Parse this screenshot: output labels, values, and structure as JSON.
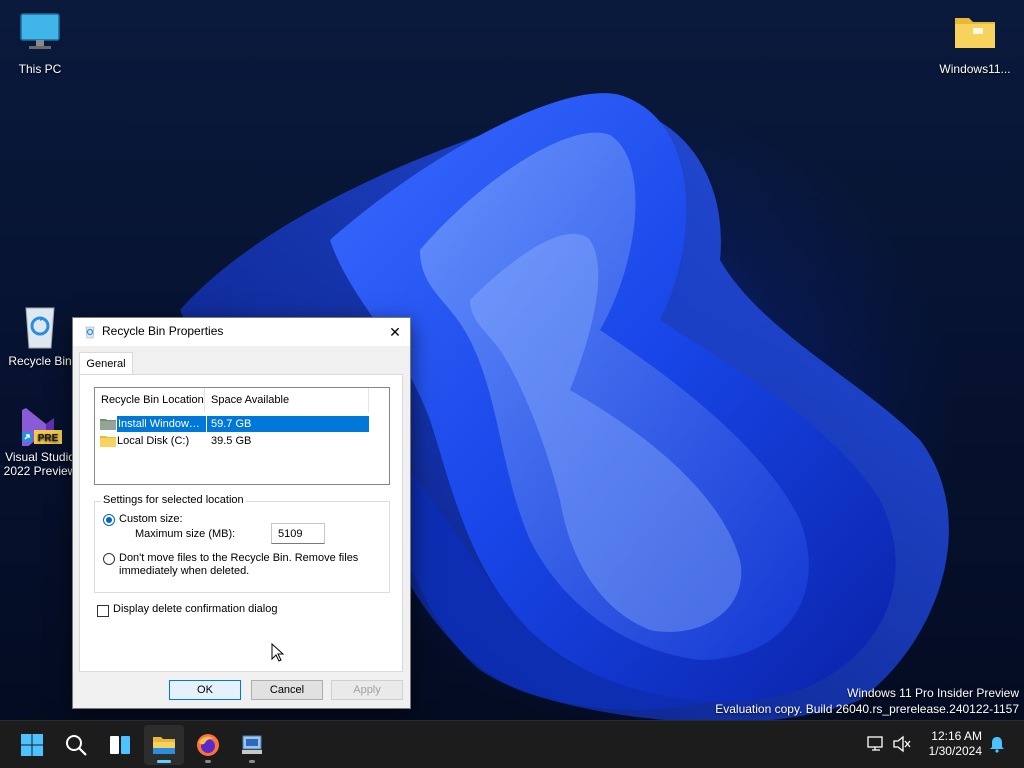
{
  "desktop": {
    "icons": [
      {
        "label": "This PC"
      },
      {
        "label": "Windows11..."
      },
      {
        "label": "Recycle Bin"
      },
      {
        "label": "Visual Studio\n2022 Preview",
        "badge": "PRE"
      }
    ],
    "watermark": {
      "line1": "Windows 11 Pro Insider Preview",
      "line2": "Evaluation copy. Build 26040.rs_prerelease.240122-1157"
    }
  },
  "dialog": {
    "title": "Recycle Bin Properties",
    "close_label": "✕",
    "tabs": [
      {
        "label": "General",
        "selected": true
      }
    ],
    "list": {
      "columns": [
        "Recycle Bin Location",
        "Space Available"
      ],
      "rows": [
        {
          "location": "Install Window…",
          "space": "59.7 GB",
          "selected": true
        },
        {
          "location": "Local Disk (C:)",
          "space": "39.5 GB",
          "selected": false
        }
      ]
    },
    "settings": {
      "legend": "Settings for selected location",
      "custom_size_label": "Custom size:",
      "custom_size_selected": true,
      "max_size_label": "Maximum size (MB):",
      "max_size_value": "5109",
      "no_move_label": "Don't move files to the Recycle Bin. Remove files immediately when deleted.",
      "no_move_selected": false
    },
    "confirm_label": "Display delete confirmation dialog",
    "confirm_checked": false,
    "buttons": {
      "ok": "OK",
      "cancel": "Cancel",
      "apply": "Apply"
    }
  },
  "taskbar": {
    "items": [
      "start-icon",
      "search-icon",
      "widgets-icon",
      "file-explorer-icon",
      "firefox-icon",
      "control-panel-icon"
    ],
    "clock": {
      "time": "12:16 AM",
      "date": "1/30/2024"
    }
  },
  "colors": {
    "accent": "#0078d7",
    "selection": "#0078d7",
    "taskbar": "#1c1c1c"
  }
}
